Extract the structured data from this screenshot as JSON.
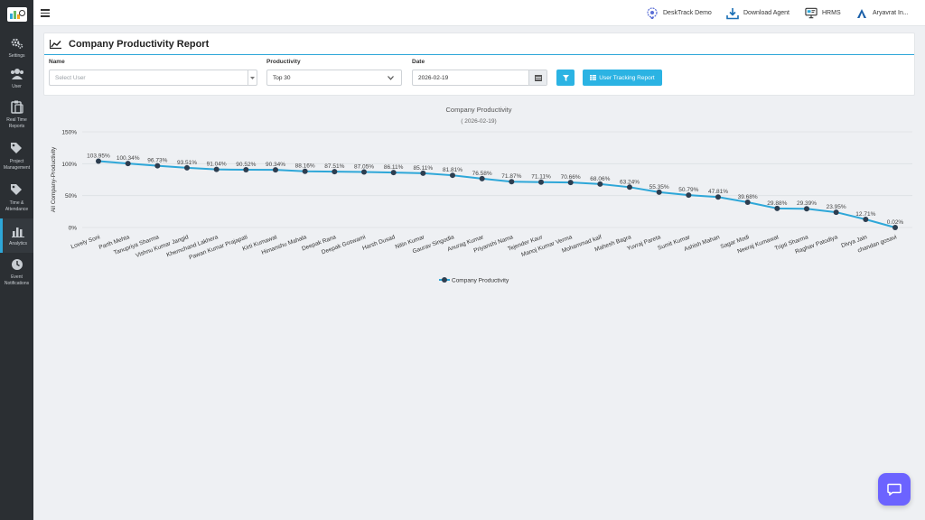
{
  "sidebar": {
    "items": [
      {
        "label": "Settings",
        "icon": "gears-icon"
      },
      {
        "label": "User",
        "icon": "users-icon"
      },
      {
        "label": "Real Time Reports",
        "icon": "clipboard-icon"
      },
      {
        "label": "Project Management",
        "icon": "tags-icon"
      },
      {
        "label": "Time & Attendance",
        "icon": "tag-icon"
      },
      {
        "label": "Analytics",
        "icon": "bar-chart-icon",
        "active": true
      },
      {
        "label": "Event Notifications",
        "icon": "clock-icon"
      }
    ]
  },
  "topbar": {
    "desktrack_demo": "DeskTrack Demo",
    "download_agent": "Download Agent",
    "hrms": "HRMS",
    "org": "Aryavrat In..."
  },
  "page": {
    "title": "Company Productivity Report"
  },
  "filters": {
    "name_label": "Name",
    "name_placeholder": "Select User",
    "productivity_label": "Productivity",
    "productivity_value": "Top 30",
    "date_label": "Date",
    "date_value": "2026-02-19",
    "user_tracking_button": "User Tracking Report"
  },
  "colors": {
    "accent": "#2bb3e3",
    "line": "#2ea7d8",
    "marker": "#2d3e50",
    "sidebar": "#2b2f33",
    "chat": "#6c63ff"
  },
  "chart_data": {
    "type": "line",
    "title": "Company Productivity",
    "subtitle": "( 2026-02-19)",
    "ylabel": "All Company-Productivity",
    "xlabel": "",
    "ylim": [
      0,
      150
    ],
    "yticks": [
      "0%",
      "50%",
      "100%",
      "150%"
    ],
    "grid": true,
    "legend": "bottom",
    "categories": [
      "Lovely Soni",
      "Parth Mehta",
      "Tanupriya Sharma",
      "Vishnu Kumar Jangid",
      "Khemchand Lakhera",
      "Pawan Kumar Prajapati",
      "Kirti Kumawat",
      "Himanshu Mahala",
      "Deepak Rana",
      "Deepak Goswami",
      "Harsh Dusad",
      "Nitin Kumar",
      "Gaurav Singodia",
      "Anurag Kumar",
      "Priyanshi Nama",
      "Tejender Kaur",
      "Manoj Kumar Verma",
      "Mohammad kaif",
      "Mahesh Bagra",
      "Yuvraj Pareta",
      "Sumit Kumar",
      "Ashish Mahan",
      "Sagar Modi",
      "Neeraj Kumawat",
      "Tripti Sharma",
      "Raghav Patodiya",
      "Divya Jain",
      "chandan gosavi"
    ],
    "series": [
      {
        "name": "Company Productivity",
        "values": [
          103.95,
          100.34,
          96.73,
          93.51,
          91.04,
          90.52,
          90.34,
          88.16,
          87.51,
          87.05,
          86.11,
          85.11,
          81.81,
          76.58,
          71.87,
          71.11,
          70.66,
          68.06,
          63.24,
          55.35,
          50.79,
          47.81,
          39.68,
          29.88,
          29.39,
          23.95,
          12.71,
          0.02
        ],
        "labels": [
          "103.95%",
          "100.34%",
          "96.73%",
          "93.51%",
          "91.04%",
          "90.52%",
          "90.34%",
          "88.16%",
          "87.51%",
          "87.05%",
          "86.11%",
          "85.11%",
          "81.81%",
          "76.58%",
          "71.87%",
          "71.11%",
          "70.66%",
          "68.06%",
          "63.24%",
          "55.35%",
          "50.79%",
          "47.81%",
          "39.68%",
          "29.88%",
          "29.39%",
          "23.95%",
          "12.71%",
          "0.02%"
        ]
      }
    ]
  }
}
